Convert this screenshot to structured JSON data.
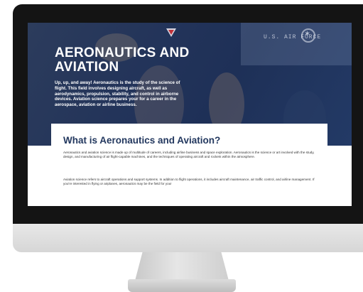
{
  "hero": {
    "title": "AERONAUTICS AND AVIATION",
    "text": "Up, up, and away! Aeronautics is the study of the science of flight. This field involves designing aircraft, as well as aerodynamics, propulsion, stability, and control in airborne devices. Aviation science prepares your for a career in the aerospace, aviation or airline business.",
    "background_text": "U.S. AIR FORCE"
  },
  "content": {
    "heading": "What is Aeronautics and Aviation?",
    "paragraph1": "Aeronautics and aviation science is made up of multitude of careers, including airline business and space exploration. Aeronautics is the science or art involved with the study, design, and manufacturing of air flight-capable machines, and the techniques of operating aircraft and rockets within the atmosphere.",
    "paragraph2": "Aviation science refers to aircraft operations and support systems. In addition to flight operations, it includes aircraft maintenance, air traffic control, and airline management. If you're interested in flying or airplanes, aeronautics may be the field for you!"
  },
  "colors": {
    "hero_overlay": "#23345a",
    "heading": "#23385f",
    "bezel": "#141414",
    "chin": "#e0e0e0"
  }
}
